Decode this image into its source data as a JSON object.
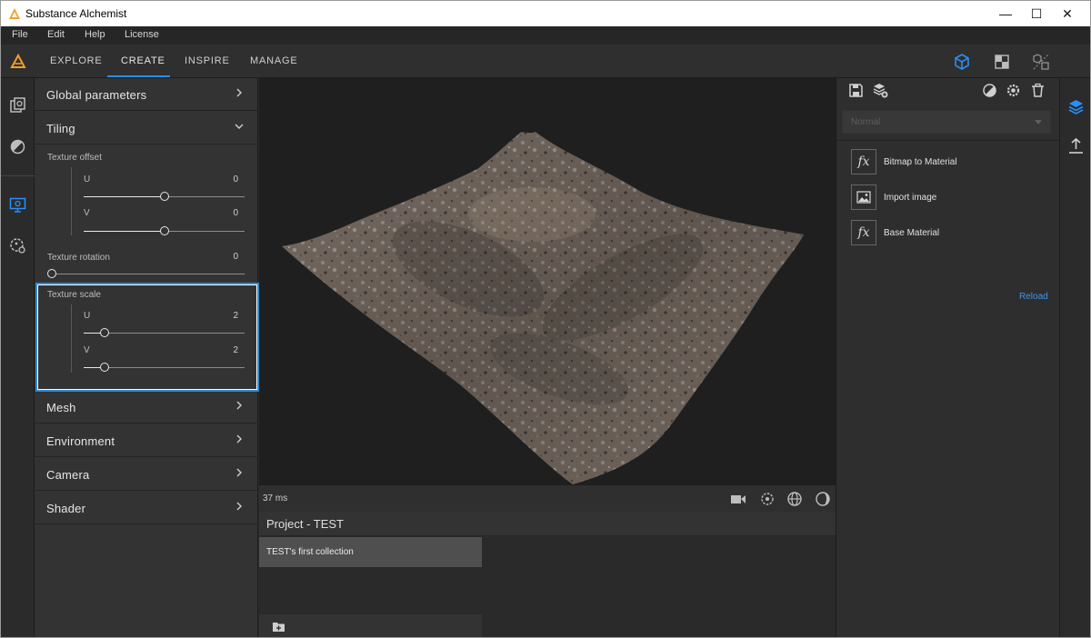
{
  "window": {
    "title": "Substance Alchemist",
    "controls": {
      "minimize": "—",
      "maximize": "☐",
      "close": "✕"
    }
  },
  "menu": [
    "File",
    "Edit",
    "Help",
    "License"
  ],
  "nav": {
    "tabs": [
      {
        "label": "EXPLORE",
        "active": false
      },
      {
        "label": "CREATE",
        "active": true
      },
      {
        "label": "INSPIRE",
        "active": false
      },
      {
        "label": "MANAGE",
        "active": false
      }
    ],
    "accent_color": "#2a8ff7",
    "view_icons": [
      "3d-cube-icon",
      "2d-texture-icon",
      "split-view-icon"
    ]
  },
  "left_rail": {
    "icons": [
      "library-icon",
      "filters-icon",
      "display-settings-icon",
      "environment-settings-icon"
    ]
  },
  "left_panel": {
    "sections": {
      "global": "Global parameters",
      "tiling": "Tiling",
      "mesh": "Mesh",
      "environment": "Environment",
      "camera": "Camera",
      "shader": "Shader"
    },
    "tiling": {
      "texture_offset": {
        "label": "Texture offset",
        "u": {
          "label": "U",
          "value": "0",
          "fraction": 0.5
        },
        "v": {
          "label": "V",
          "value": "0",
          "fraction": 0.5
        }
      },
      "texture_rotation": {
        "label": "Texture rotation",
        "value": "0",
        "fraction": 0.0
      },
      "texture_scale": {
        "label": "Texture scale",
        "u": {
          "label": "U",
          "value": "2",
          "fraction": 0.13
        },
        "v": {
          "label": "V",
          "value": "2",
          "fraction": 0.13
        }
      }
    },
    "highlight_color": "#2d8ad8"
  },
  "viewport": {
    "render_time": "37 ms",
    "tools": [
      "camera-icon",
      "light-rotate-icon",
      "environment-icon",
      "material-sphere-icon"
    ]
  },
  "project": {
    "title": "Project - TEST",
    "collections": [
      "TEST's first collection"
    ],
    "footer_icon": "add-folder-icon"
  },
  "right_panel": {
    "toolbar_icons": [
      "save-icon",
      "add-layer-icon",
      "contrast-icon",
      "settings-icon",
      "trash-icon"
    ],
    "blend_mode": "Normal",
    "layers": [
      {
        "label": "Bitmap to Material",
        "icon": "fx-icon"
      },
      {
        "label": "Import image",
        "icon": "image-icon"
      },
      {
        "label": "Base Material",
        "icon": "fx-icon"
      }
    ],
    "reload_label": "Reload",
    "link_color": "#3d95ea"
  },
  "right_rail": {
    "icons": [
      "layers-icon",
      "export-icon"
    ]
  }
}
